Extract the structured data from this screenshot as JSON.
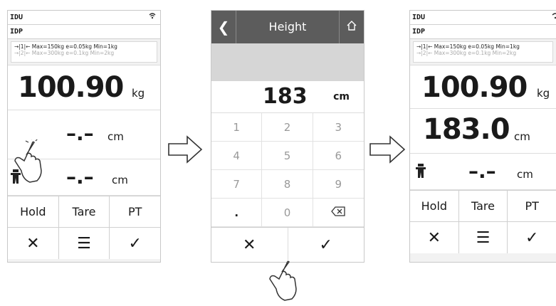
{
  "screen1": {
    "id_line1": "IDU",
    "id_line2": "IDP",
    "range1": "→|1|← Max=150kg e=0.05kg Min=1kg",
    "range2": "→|2|← Max=300kg e=0.1kg Min=2kg",
    "weight_value": "100.90",
    "weight_unit": "kg",
    "height_placeholder": "–.–",
    "height_unit": "cm",
    "bmi_placeholder": "–.–",
    "bmi_unit": "cm",
    "btn_hold": "Hold",
    "btn_tare": "Tare",
    "btn_pt": "PT"
  },
  "screen2": {
    "title": "Height",
    "value": "183",
    "unit": "cm",
    "keys": [
      "1",
      "2",
      "3",
      "4",
      "5",
      "6",
      "7",
      "8",
      "9",
      ".",
      "0"
    ]
  },
  "screen3": {
    "id_line1": "IDU",
    "id_line2": "IDP",
    "range1": "→|1|← Max=150kg e=0.05kg Min=1kg",
    "range2": "→|2|← Max=300kg e=0.1kg Min=2kg",
    "weight_value": "100.90",
    "weight_unit": "kg",
    "height_value": "183.0",
    "height_unit": "cm",
    "bmi_placeholder": "–.–",
    "bmi_unit": "cm",
    "btn_hold": "Hold",
    "btn_tare": "Tare",
    "btn_pt": "PT"
  },
  "icons": {
    "wifi": "wifi-icon",
    "hand": "pointing-hand-icon",
    "person": "person-icon",
    "arrow": "right-arrow-icon"
  }
}
